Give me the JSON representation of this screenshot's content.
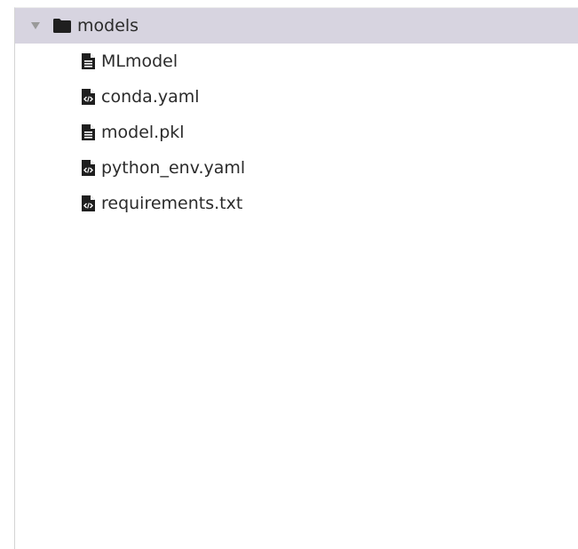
{
  "tree": {
    "folder": {
      "label": "models",
      "expanded": true,
      "caret_icon": "caret-down-icon",
      "icon": "folder-icon"
    },
    "files": [
      {
        "label": "MLmodel",
        "icon": "document-icon"
      },
      {
        "label": "conda.yaml",
        "icon": "code-file-icon"
      },
      {
        "label": "model.pkl",
        "icon": "document-icon"
      },
      {
        "label": "python_env.yaml",
        "icon": "code-file-icon"
      },
      {
        "label": "requirements.txt",
        "icon": "code-file-icon"
      }
    ]
  },
  "colors": {
    "selected_row": "#d7d4e0",
    "text": "#2b2b2b",
    "icon": "#1f1f1f",
    "caret": "#9a9a9a"
  }
}
